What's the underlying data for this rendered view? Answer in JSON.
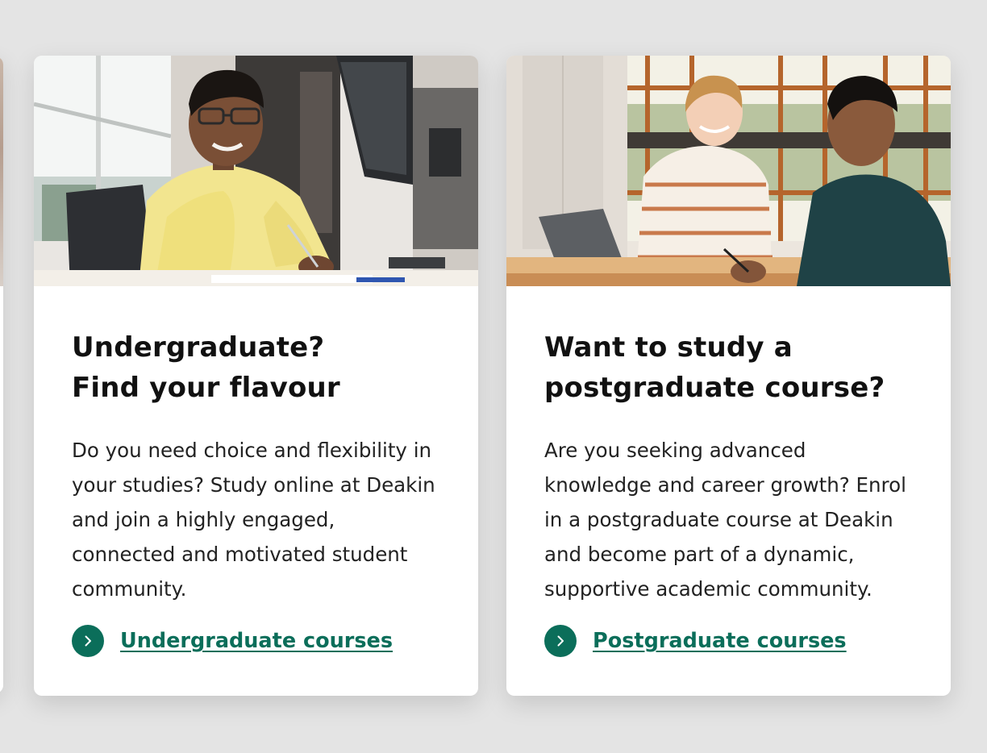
{
  "cards": [
    {
      "image_alt": "student-in-yellow-sweater-writing-at-desk",
      "title_lines": [
        "Undergraduate?",
        "Find your flavour"
      ],
      "description_lines": [
        "Do you need choice and flexibility in",
        "your studies? Study online at Deakin",
        "and join a highly engaged,",
        "connected and motivated student",
        "community."
      ],
      "link_label": "Undergraduate courses",
      "link_icon": "chevron-right-icon"
    },
    {
      "image_alt": "two-students-talking-with-laptop",
      "title_lines": [
        "Want to study a",
        "postgraduate course?"
      ],
      "description_lines": [
        "Are you seeking advanced",
        "knowledge and career growth? Enrol",
        "in a postgraduate course at Deakin",
        "and become part of a dynamic,",
        "supportive academic community."
      ],
      "link_label": "Postgraduate courses",
      "link_icon": "chevron-right-icon"
    }
  ],
  "colors": {
    "accent": "#0b6e5a",
    "background": "#e4e4e4",
    "card": "#ffffff",
    "heading": "#111111"
  }
}
